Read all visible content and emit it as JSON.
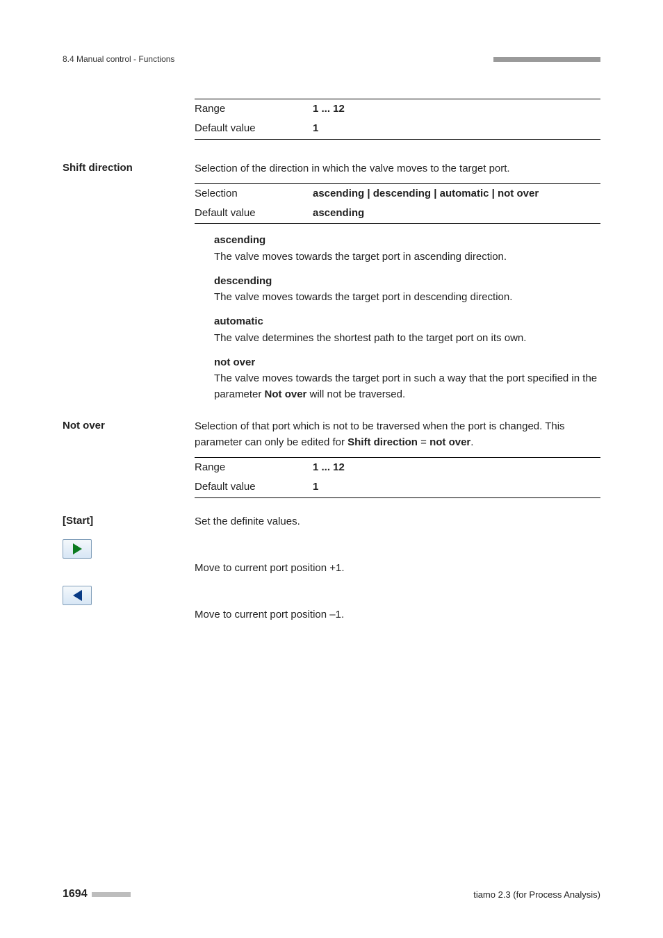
{
  "header": {
    "section": "8.4 Manual control - Functions"
  },
  "table1": {
    "range_label": "Range",
    "range_value": "1 ... 12",
    "default_label": "Default value",
    "default_value": "1"
  },
  "shiftDirection": {
    "heading": "Shift direction",
    "desc": "Selection of the direction in which the valve moves to the target port.",
    "tbl": {
      "selection_label": "Selection",
      "selection_value": "ascending | descending | automatic | not over",
      "default_label": "Default value",
      "default_value": "ascending"
    },
    "defs": {
      "asc_term": "ascending",
      "asc_def": "The valve moves towards the target port in ascending direction.",
      "desc_term": "descending",
      "desc_def": "The valve moves towards the target port in descending direction.",
      "auto_term": "automatic",
      "auto_def": "The valve determines the shortest path to the target port on its own.",
      "nov_term": "not over",
      "nov_def_a": "The valve moves towards the target port in such a way that the port specified in the parameter ",
      "nov_def_bold": "Not over",
      "nov_def_b": " will not be traversed."
    }
  },
  "notOver": {
    "heading": "Not over",
    "desc_a": "Selection of that port which is not to be traversed when the port is changed. This parameter can only be edited for ",
    "desc_bold1": "Shift direction",
    "desc_mid": " = ",
    "desc_bold2": "not over",
    "desc_end": ".",
    "tbl": {
      "range_label": "Range",
      "range_value": "1 ... 12",
      "default_label": "Default value",
      "default_value": "1"
    }
  },
  "start": {
    "heading": "[Start]",
    "desc": "Set the definite values.",
    "fwd": "Move to current port position +1.",
    "back": "Move to current port position –1."
  },
  "footer": {
    "page": "1694",
    "product": "tiamo 2.3 (for Process Analysis)"
  }
}
